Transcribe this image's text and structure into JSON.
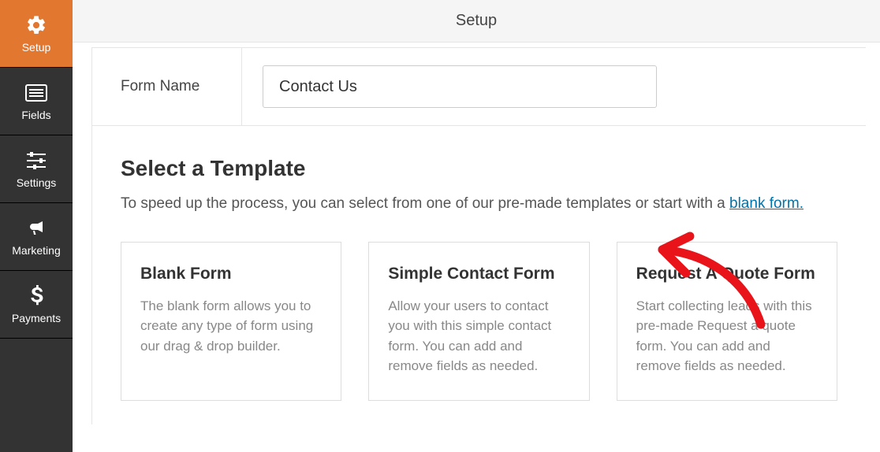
{
  "topbar": {
    "title": "Setup"
  },
  "sidebar": {
    "items": [
      {
        "label": "Setup"
      },
      {
        "label": "Fields"
      },
      {
        "label": "Settings"
      },
      {
        "label": "Marketing"
      },
      {
        "label": "Payments"
      }
    ]
  },
  "form_name": {
    "label": "Form Name",
    "value": "Contact Us"
  },
  "template_section": {
    "heading": "Select a Template",
    "lead_prefix": "To speed up the process, you can select from one of our pre-made templates or start with a ",
    "lead_link": "blank form."
  },
  "templates": [
    {
      "title": "Blank Form",
      "desc": "The blank form allows you to create any type of form using our drag & drop builder."
    },
    {
      "title": "Simple Contact Form",
      "desc": "Allow your users to contact you with this simple contact form. You can add and remove fields as needed."
    },
    {
      "title": "Request A Quote Form",
      "desc": "Start collecting leads with this pre-made Request a quote form. You can add and remove fields as needed."
    }
  ]
}
